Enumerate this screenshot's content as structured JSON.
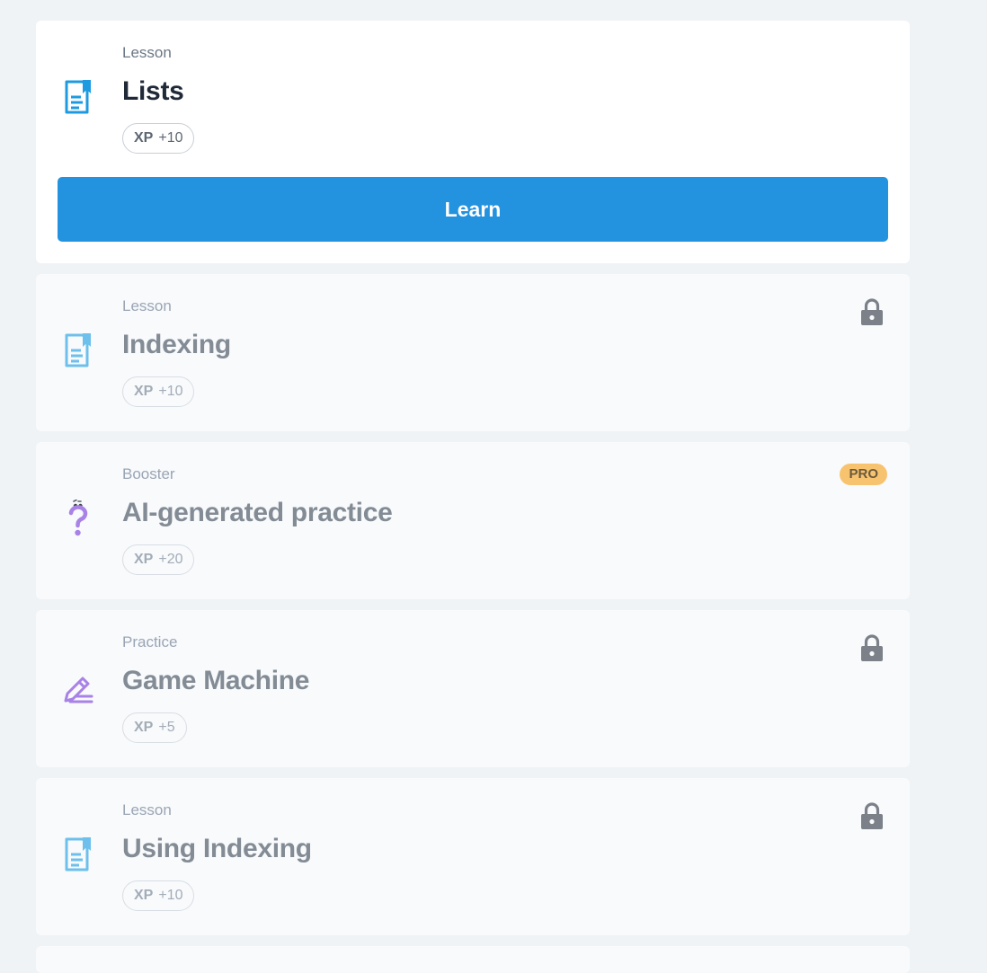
{
  "lessons": [
    {
      "type": "Lesson",
      "title": "Lists",
      "xp_tag": "XP",
      "xp_value": "+10",
      "icon": "lesson-document-icon",
      "button_label": "Learn"
    },
    {
      "type": "Lesson",
      "title": "Indexing",
      "xp_tag": "XP",
      "xp_value": "+10",
      "icon": "lesson-document-icon",
      "status_icon": "lock-icon"
    },
    {
      "type": "Booster",
      "title": "AI-generated practice",
      "xp_tag": "XP",
      "xp_value": "+20",
      "icon": "question-mark-icon",
      "badge": "PRO"
    },
    {
      "type": "Practice",
      "title": "Game Machine",
      "xp_tag": "XP",
      "xp_value": "+5",
      "icon": "pencil-edit-icon",
      "status_icon": "lock-icon"
    },
    {
      "type": "Lesson",
      "title": "Using Indexing",
      "xp_tag": "XP",
      "xp_value": "+10",
      "icon": "lesson-document-icon",
      "status_icon": "lock-icon"
    }
  ],
  "colors": {
    "accent": "#2392df",
    "lesson_icon_active": "#1e9be0",
    "lesson_icon_muted": "#6ec0ec",
    "purple_icon": "#a882e6",
    "lock": "#7b8089",
    "pro_badge": "#f8c36e",
    "page_background": "#f0f3f6"
  }
}
